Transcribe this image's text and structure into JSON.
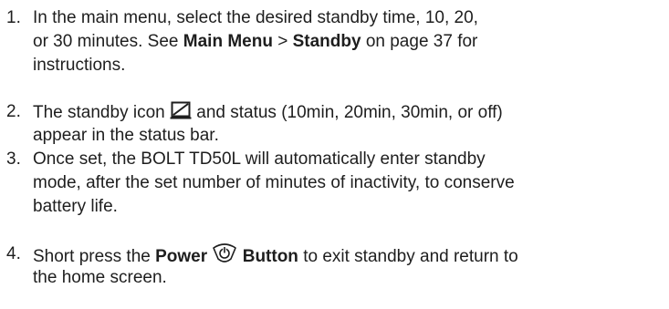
{
  "steps": [
    {
      "number": "1.",
      "line1": "In the main menu, select the desired standby time, 10, 20,",
      "line2_a": "or 30 minutes. See ",
      "line2_b": "Main Menu",
      "line2_c": " > ",
      "line2_d": "Standby",
      "line2_e": " on page 37 for",
      "line3": "instructions."
    },
    {
      "number": "2.",
      "line1_a": "The standby icon ",
      "line1_icon": "standby-icon",
      "line1_b": " and status (10min, 20min, 30min, or off)",
      "line2": "appear in the status bar."
    },
    {
      "number": "3.",
      "line1": "Once set, the BOLT TD50L will automatically enter standby",
      "line2": "mode, after the set number of minutes of inactivity, to conserve",
      "line3": "battery life."
    },
    {
      "number": "4.",
      "line1_a": "Short press the ",
      "line1_b": "Power",
      "line1_icon": "power-button-icon",
      "line1_c": "Button",
      "line1_d": " to exit standby and return to",
      "line2": "the home screen."
    }
  ]
}
